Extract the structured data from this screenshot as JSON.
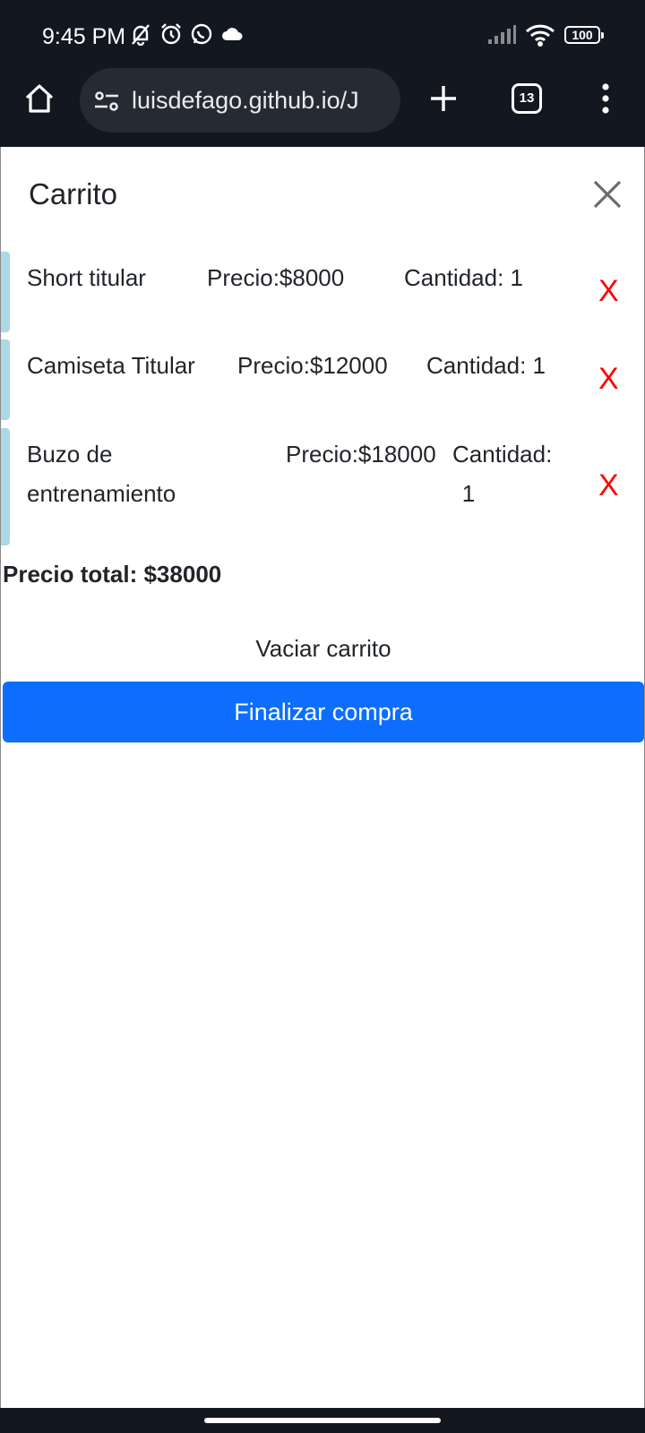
{
  "status_bar": {
    "time": "9:45 PM",
    "icons_left": [
      "bell-off-icon",
      "alarm-icon",
      "whatsapp-icon",
      "cloud-icon"
    ],
    "icons_right": [
      "signal-icon",
      "wifi-icon",
      "battery-icon"
    ],
    "battery": "100"
  },
  "browser": {
    "url": "luisdefago.github.io/J",
    "tab_count": "13"
  },
  "cart": {
    "title": "Carrito",
    "items": [
      {
        "name": "Short titular",
        "price": "Precio:$8000",
        "qty": "Cantidad: 1",
        "remove": "X"
      },
      {
        "name": "Camiseta Titular",
        "price": "Precio:$12000",
        "qty": "Cantidad: 1",
        "remove": "X"
      },
      {
        "name_line1": "Buzo de",
        "name_line2": "entrenamiento",
        "price": "Precio:$18000",
        "qty_line1": "Cantidad:",
        "qty_line2": "1",
        "remove": "X"
      }
    ],
    "total": "Precio total: $38000",
    "empty_label": "Vaciar carrito",
    "checkout_label": "Finalizar compra"
  },
  "colors": {
    "primary": "#0d6efd",
    "remove": "#ff0000",
    "item_accent": "#add8e6",
    "chrome": "#13171f"
  }
}
